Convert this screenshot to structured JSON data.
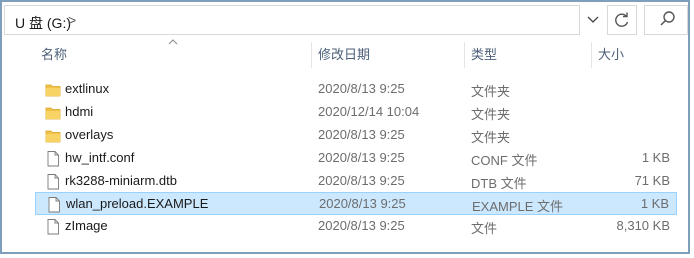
{
  "address": {
    "location": "U 盘 (G:)",
    "separator": ">"
  },
  "toolbar": {
    "dropdown_icon": "chevron-down-icon",
    "refresh_icon": "refresh-icon",
    "search_icon": "search-icon"
  },
  "columns": {
    "name": "名称",
    "date": "修改日期",
    "type": "类型",
    "size": "大小"
  },
  "files": [
    {
      "name": "extlinux",
      "date": "2020/8/13 9:25",
      "type": "文件夹",
      "size": "",
      "icon": "folder-icon"
    },
    {
      "name": "hdmi",
      "date": "2020/12/14 10:04",
      "type": "文件夹",
      "size": "",
      "icon": "folder-icon"
    },
    {
      "name": "overlays",
      "date": "2020/8/13 9:25",
      "type": "文件夹",
      "size": "",
      "icon": "folder-icon"
    },
    {
      "name": "hw_intf.conf",
      "date": "2020/8/13 9:25",
      "type": "CONF 文件",
      "size": "1 KB",
      "icon": "file-icon"
    },
    {
      "name": "rk3288-miniarm.dtb",
      "date": "2020/8/13 9:25",
      "type": "DTB 文件",
      "size": "71 KB",
      "icon": "file-icon"
    },
    {
      "name": "wlan_preload.EXAMPLE",
      "date": "2020/8/13 9:25",
      "type": "EXAMPLE 文件",
      "size": "1 KB",
      "icon": "file-icon",
      "selected": true
    },
    {
      "name": "zImage",
      "date": "2020/8/13 9:25",
      "type": "文件",
      "size": "8,310 KB",
      "icon": "file-icon"
    }
  ],
  "colors": {
    "selected_bg": "#cce8ff",
    "selected_border": "#99d1ff",
    "header_text": "#4c607a",
    "folder_yellow": "#f0c24a"
  }
}
